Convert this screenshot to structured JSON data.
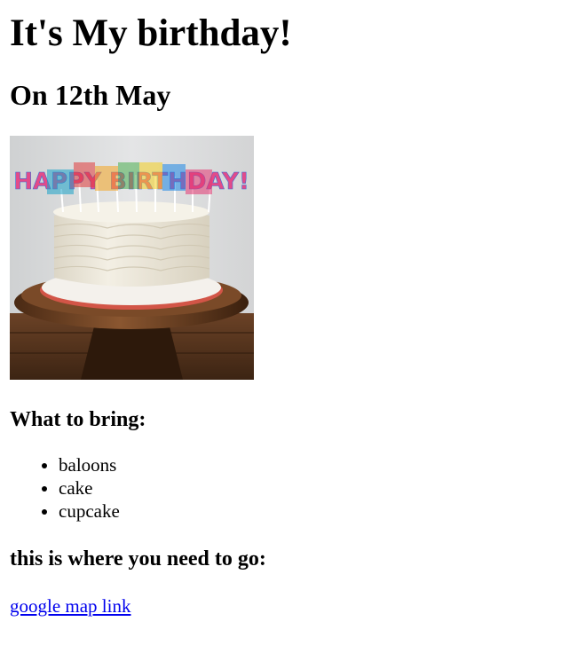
{
  "page": {
    "title": "It's My birthday!",
    "subtitle": "On 12th May",
    "image_label": "HAPPY BIRTHDAY!"
  },
  "bring": {
    "heading": "What to bring:",
    "items": [
      "baloons",
      "cake",
      "cupcake"
    ]
  },
  "location": {
    "heading": "this is where you need to go:",
    "link_text": "google map link"
  },
  "colors": {
    "link": "#0000ee",
    "text": "#000000",
    "background": "#ffffff"
  }
}
